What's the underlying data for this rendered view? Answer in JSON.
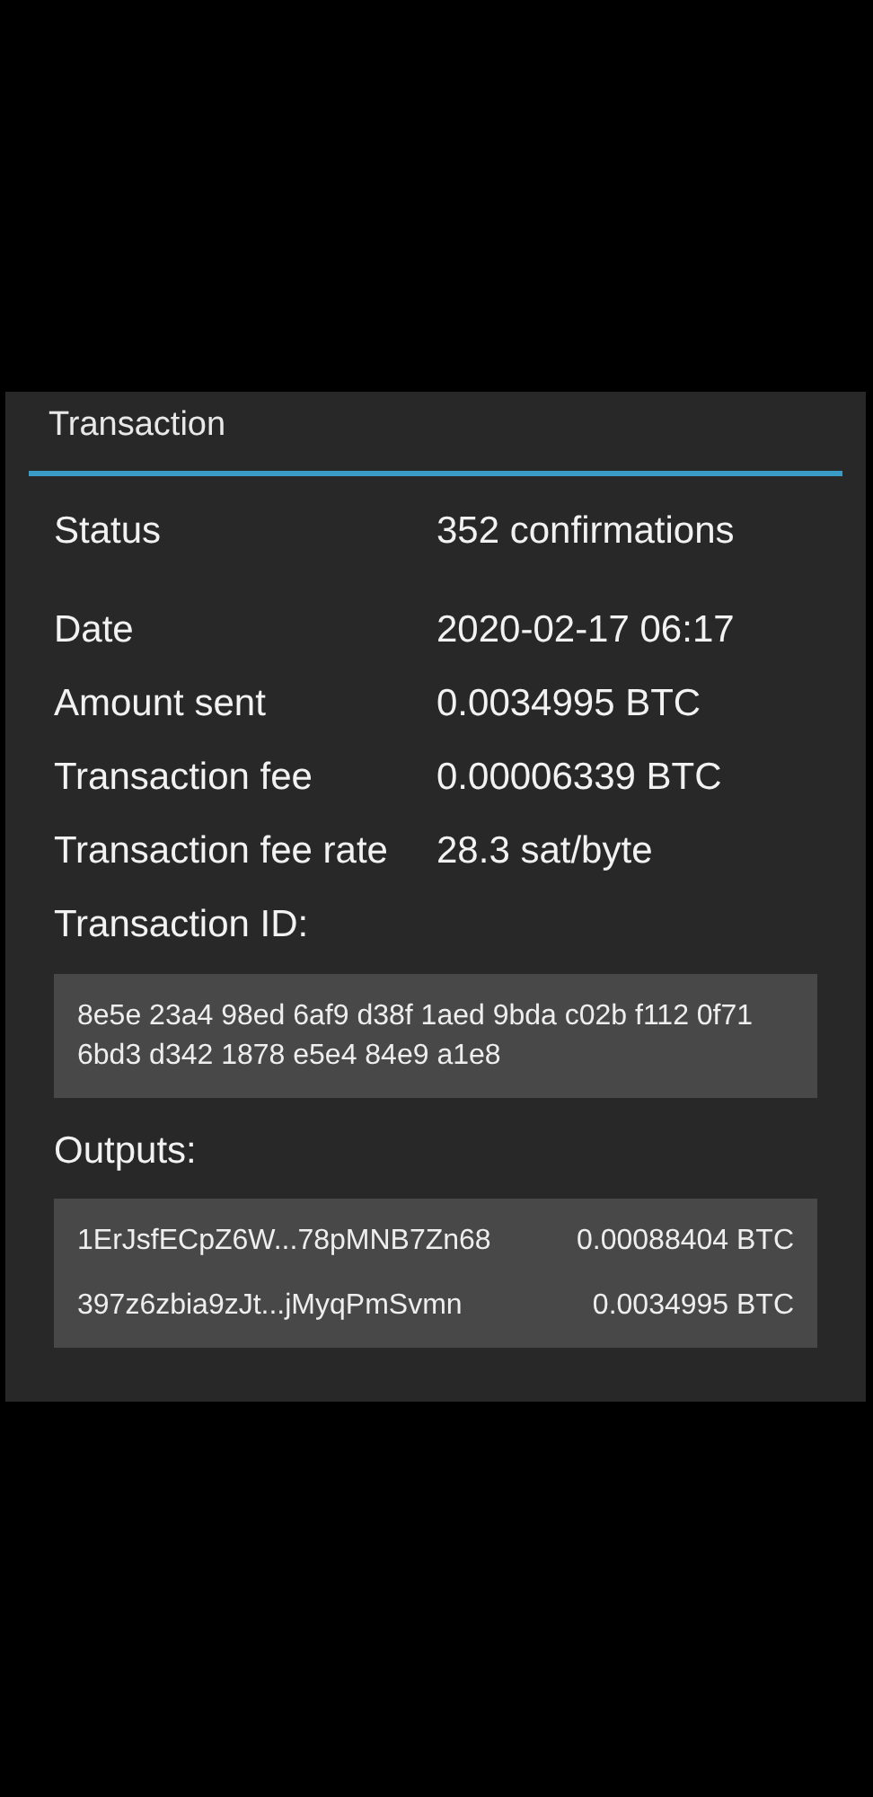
{
  "dialog": {
    "title": "Transaction",
    "fields": [
      {
        "label": "Status",
        "value": "352 confirmations"
      },
      {
        "label": "Date",
        "value": "2020-02-17 06:17"
      },
      {
        "label": "Amount sent",
        "value": "0.0034995 BTC"
      },
      {
        "label": "Transaction fee",
        "value": "0.00006339 BTC"
      },
      {
        "label": "Transaction fee rate",
        "value": "28.3 sat/byte"
      }
    ],
    "transaction_id": {
      "label": "Transaction ID:",
      "value": "8e5e 23a4 98ed 6af9 d38f 1aed 9bda c02b f112 0f71 6bd3 d342 1878 e5e4 84e9 a1e8"
    },
    "outputs": {
      "label": "Outputs:",
      "rows": [
        {
          "address": "1ErJsfECpZ6W...78pMNB7Zn68",
          "amount": "0.00088404 BTC"
        },
        {
          "address": "397z6zbia9zJt...jMyqPmSvmn",
          "amount": "0.0034995 BTC"
        }
      ]
    }
  }
}
